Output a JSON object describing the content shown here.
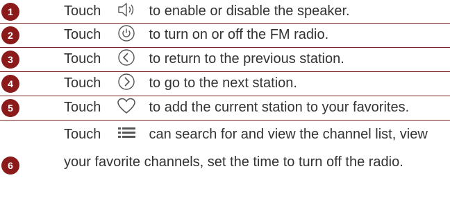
{
  "rows": [
    {
      "num": "1",
      "touch": "Touch",
      "icon": "speaker-icon",
      "desc": "to enable or disable the speaker."
    },
    {
      "num": "2",
      "touch": "Touch",
      "icon": "power-icon",
      "desc": "to turn on or off the FM radio."
    },
    {
      "num": "3",
      "touch": "Touch",
      "icon": "previous-icon",
      "desc": "to return to the previous station."
    },
    {
      "num": "4",
      "touch": "Touch",
      "icon": "next-icon",
      "desc": "to go to the next station."
    },
    {
      "num": "5",
      "touch": "Touch",
      "icon": "heart-icon",
      "desc": "to add the current station to your favorites."
    },
    {
      "num": "6",
      "touch": "Touch",
      "icon": "list-icon",
      "desc": "can search for and view the channel list, view",
      "desc2": "your favorite channels, set the time to turn off the radio."
    }
  ],
  "colors": {
    "badge": "#8b1a1a",
    "divider": "#7a1d1d",
    "text": "#333333"
  }
}
